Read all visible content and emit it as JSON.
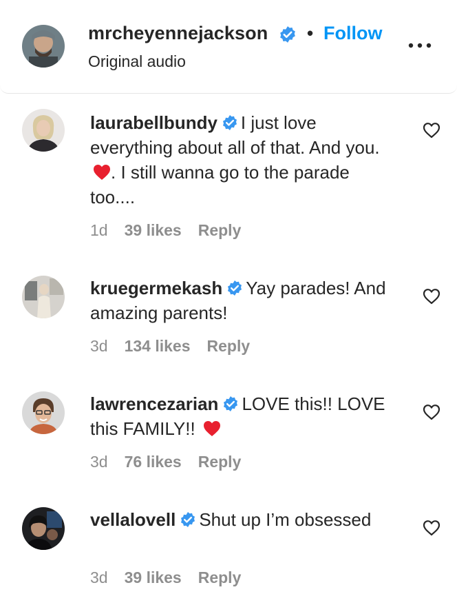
{
  "header": {
    "username": "mrcheyennejackson",
    "separator": "•",
    "follow_label": "Follow",
    "subtitle": "Original audio"
  },
  "colors": {
    "text": "#262626",
    "muted": "#8e8e8e",
    "follow": "#0095f6",
    "verified": "#3897f0",
    "heart_emoji": "#e8202f"
  },
  "icons": {
    "verified": "verified-badge-icon",
    "more": "more-options-icon",
    "like": "heart-outline-icon",
    "emoji": "red-heart-emoji"
  },
  "comments": [
    {
      "username": "laurabellbundy",
      "text_before_emoji": "I just love everything about all of that. And you. ",
      "text_after_emoji": ". I still wanna go to the parade too....",
      "age": "1d",
      "likes": "39 likes",
      "reply": "Reply"
    },
    {
      "username": "kruegermekash",
      "text_before_emoji": "Yay parades! And amazing parents!",
      "text_after_emoji": "",
      "age": "3d",
      "likes": "134 likes",
      "reply": "Reply"
    },
    {
      "username": "lawrencezarian",
      "text_before_emoji": "LOVE this!! LOVE this FAMILY!! ",
      "text_after_emoji": "",
      "age": "3d",
      "likes": "76 likes",
      "reply": "Reply"
    },
    {
      "username": "vellalovell",
      "text_before_emoji": "Shut up I’m obsessed",
      "text_after_emoji": "",
      "age": "3d",
      "likes": "39 likes",
      "reply": "Reply"
    }
  ]
}
